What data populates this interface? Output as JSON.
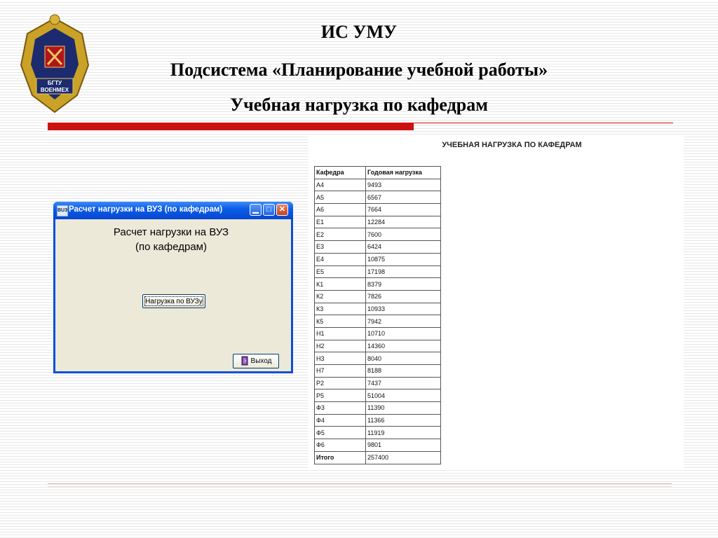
{
  "header": {
    "line1": "ИС УМУ",
    "line2": "Подсистема «Планирование учебной работы»",
    "line3": "Учебная нагрузка по кафедрам"
  },
  "logo": {
    "icon": "double-headed-eagle-emblem",
    "text_top": "БГТУ",
    "text_mid": "ВОЕНМЕХ"
  },
  "colors": {
    "accent_bar": "#cc1111",
    "titlebar": "#0b5de8",
    "window_body": "#ece9d8"
  },
  "window": {
    "icon_text": "BUЗ",
    "title": "Расчет нагрузки на ВУЗ (по кафедрам)",
    "heading_line1": "Расчет нагрузки на ВУЗ",
    "heading_line2": "(по кафедрам)",
    "load_button": "Нагрузка по ВУЗу",
    "exit_button": "Выход"
  },
  "report": {
    "title": "УЧЕБНАЯ НАГРУЗКА ПО КАФЕДРАМ",
    "columns": [
      "Кафедра",
      "Годовая нагрузка"
    ],
    "rows": [
      [
        "А4",
        "9493"
      ],
      [
        "А5",
        "6567"
      ],
      [
        "А6",
        "7664"
      ],
      [
        "Е1",
        "12284"
      ],
      [
        "Е2",
        "7600"
      ],
      [
        "Е3",
        "6424"
      ],
      [
        "Е4",
        "10875"
      ],
      [
        "Е5",
        "17198"
      ],
      [
        "К1",
        "8379"
      ],
      [
        "К2",
        "7826"
      ],
      [
        "К3",
        "10933"
      ],
      [
        "К5",
        "7942"
      ],
      [
        "Н1",
        "10710"
      ],
      [
        "Н2",
        "14360"
      ],
      [
        "Н3",
        "8040"
      ],
      [
        "Н7",
        "8188"
      ],
      [
        "Р2",
        "7437"
      ],
      [
        "Р5",
        "51004"
      ],
      [
        "Ф3",
        "11390"
      ],
      [
        "Ф4",
        "11366"
      ],
      [
        "Ф5",
        "11919"
      ],
      [
        "Ф6",
        "9801"
      ]
    ],
    "total": [
      "Итого",
      "257400"
    ]
  }
}
